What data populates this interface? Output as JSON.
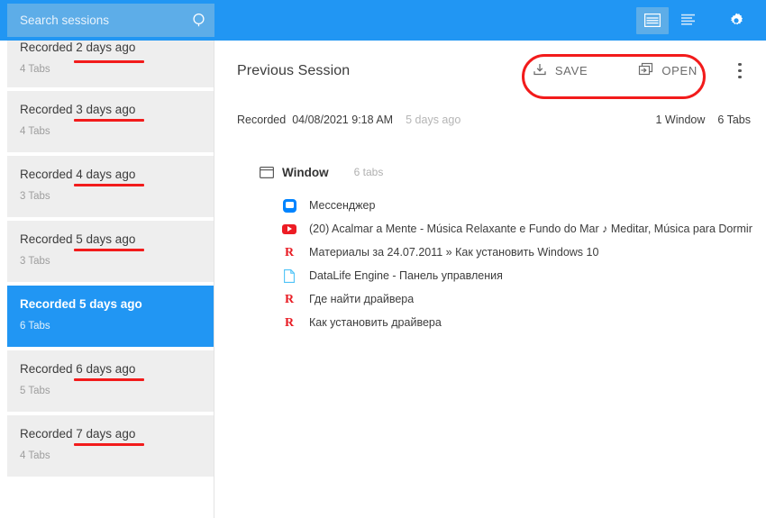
{
  "colors": {
    "header_blue": "#2196f3",
    "search_blue": "#5dade8",
    "annotation_red": "#f21b1b",
    "card_gray": "#eeeeee"
  },
  "topbar": {
    "search": {
      "placeholder": "Search sessions",
      "value": "",
      "icon": "search-icon"
    },
    "view_grid_icon": "view-list-dense-icon",
    "view_list_icon": "view-list-icon",
    "settings_icon": "gear-icon"
  },
  "sidebar": {
    "sessions": [
      {
        "title": "Recorded 2 days ago",
        "tabs": "4 Tabs",
        "selected": false,
        "annotated": true
      },
      {
        "title": "Recorded 3 days ago",
        "tabs": "4 Tabs",
        "selected": false,
        "annotated": true
      },
      {
        "title": "Recorded 4 days ago",
        "tabs": "3 Tabs",
        "selected": false,
        "annotated": true
      },
      {
        "title": "Recorded 5 days ago",
        "tabs": "3 Tabs",
        "selected": false,
        "annotated": true
      },
      {
        "title": "Recorded 5 days ago",
        "tabs": "6 Tabs",
        "selected": true,
        "annotated": false
      },
      {
        "title": "Recorded 6 days ago",
        "tabs": "5 Tabs",
        "selected": false,
        "annotated": true
      },
      {
        "title": "Recorded 7 days ago",
        "tabs": "4 Tabs",
        "selected": false,
        "annotated": true
      }
    ]
  },
  "main": {
    "title": "Previous Session",
    "save_label": "SAVE",
    "save_icon": "save-download-icon",
    "open_label": "OPEN",
    "open_icon": "open-in-window-icon",
    "kebab_icon": "more-vertical-icon",
    "meta": {
      "recorded_label": "Recorded",
      "recorded_date": "04/08/2021 9:18 AM",
      "relative": "5 days ago",
      "windows": "1 Window",
      "tabs": "6 Tabs"
    },
    "window": {
      "icon": "window-icon",
      "label": "Window",
      "count": "6 tabs"
    },
    "tabs": [
      {
        "favicon": "messenger-icon",
        "title": "Мессенджер"
      },
      {
        "favicon": "youtube-icon",
        "title": "(20) Acalmar a Mente - Música Relaxante e Fundo do Mar ♪ Meditar, Música para Dormir"
      },
      {
        "favicon": "remontka-icon",
        "title": "Материалы за 24.07.2011 » Как установить Windows 10"
      },
      {
        "favicon": "page-icon",
        "title": "DataLife Engine - Панель управления"
      },
      {
        "favicon": "remontka-icon",
        "title": "Где найти драйвера"
      },
      {
        "favicon": "remontka-icon",
        "title": "Как установить драйвера"
      }
    ]
  }
}
